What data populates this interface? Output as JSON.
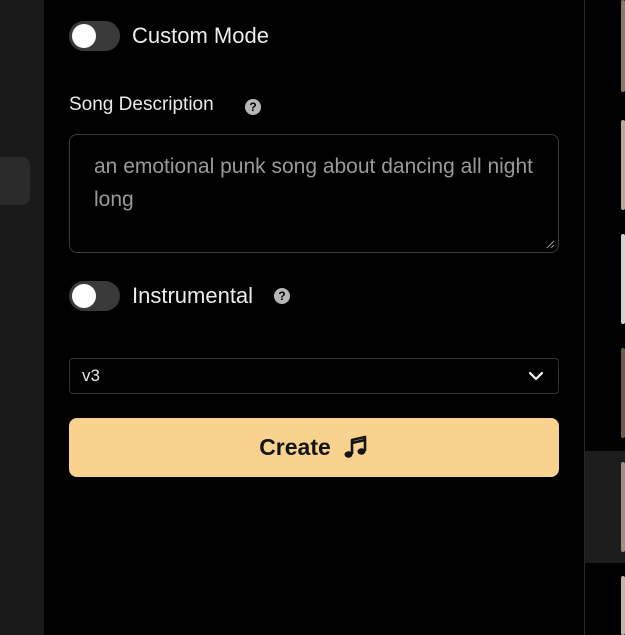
{
  "custom_mode": {
    "label": "Custom Mode",
    "enabled": false
  },
  "song_description": {
    "label": "Song Description",
    "help_icon": "question-circle-icon",
    "value": "an emotional punk song about dancing all night long"
  },
  "instrumental": {
    "label": "Instrumental",
    "enabled": false,
    "help_icon": "question-circle-icon"
  },
  "model_select": {
    "value": "v3",
    "icon": "chevron-down-icon"
  },
  "create_button": {
    "label": "Create",
    "icon": "music-note-icon",
    "color": "#FAD290"
  },
  "colors": {
    "background": "#000000",
    "sidebar": "#1A1A1A",
    "accent": "#FAD290",
    "toggle_off": "#3A3A3A"
  }
}
